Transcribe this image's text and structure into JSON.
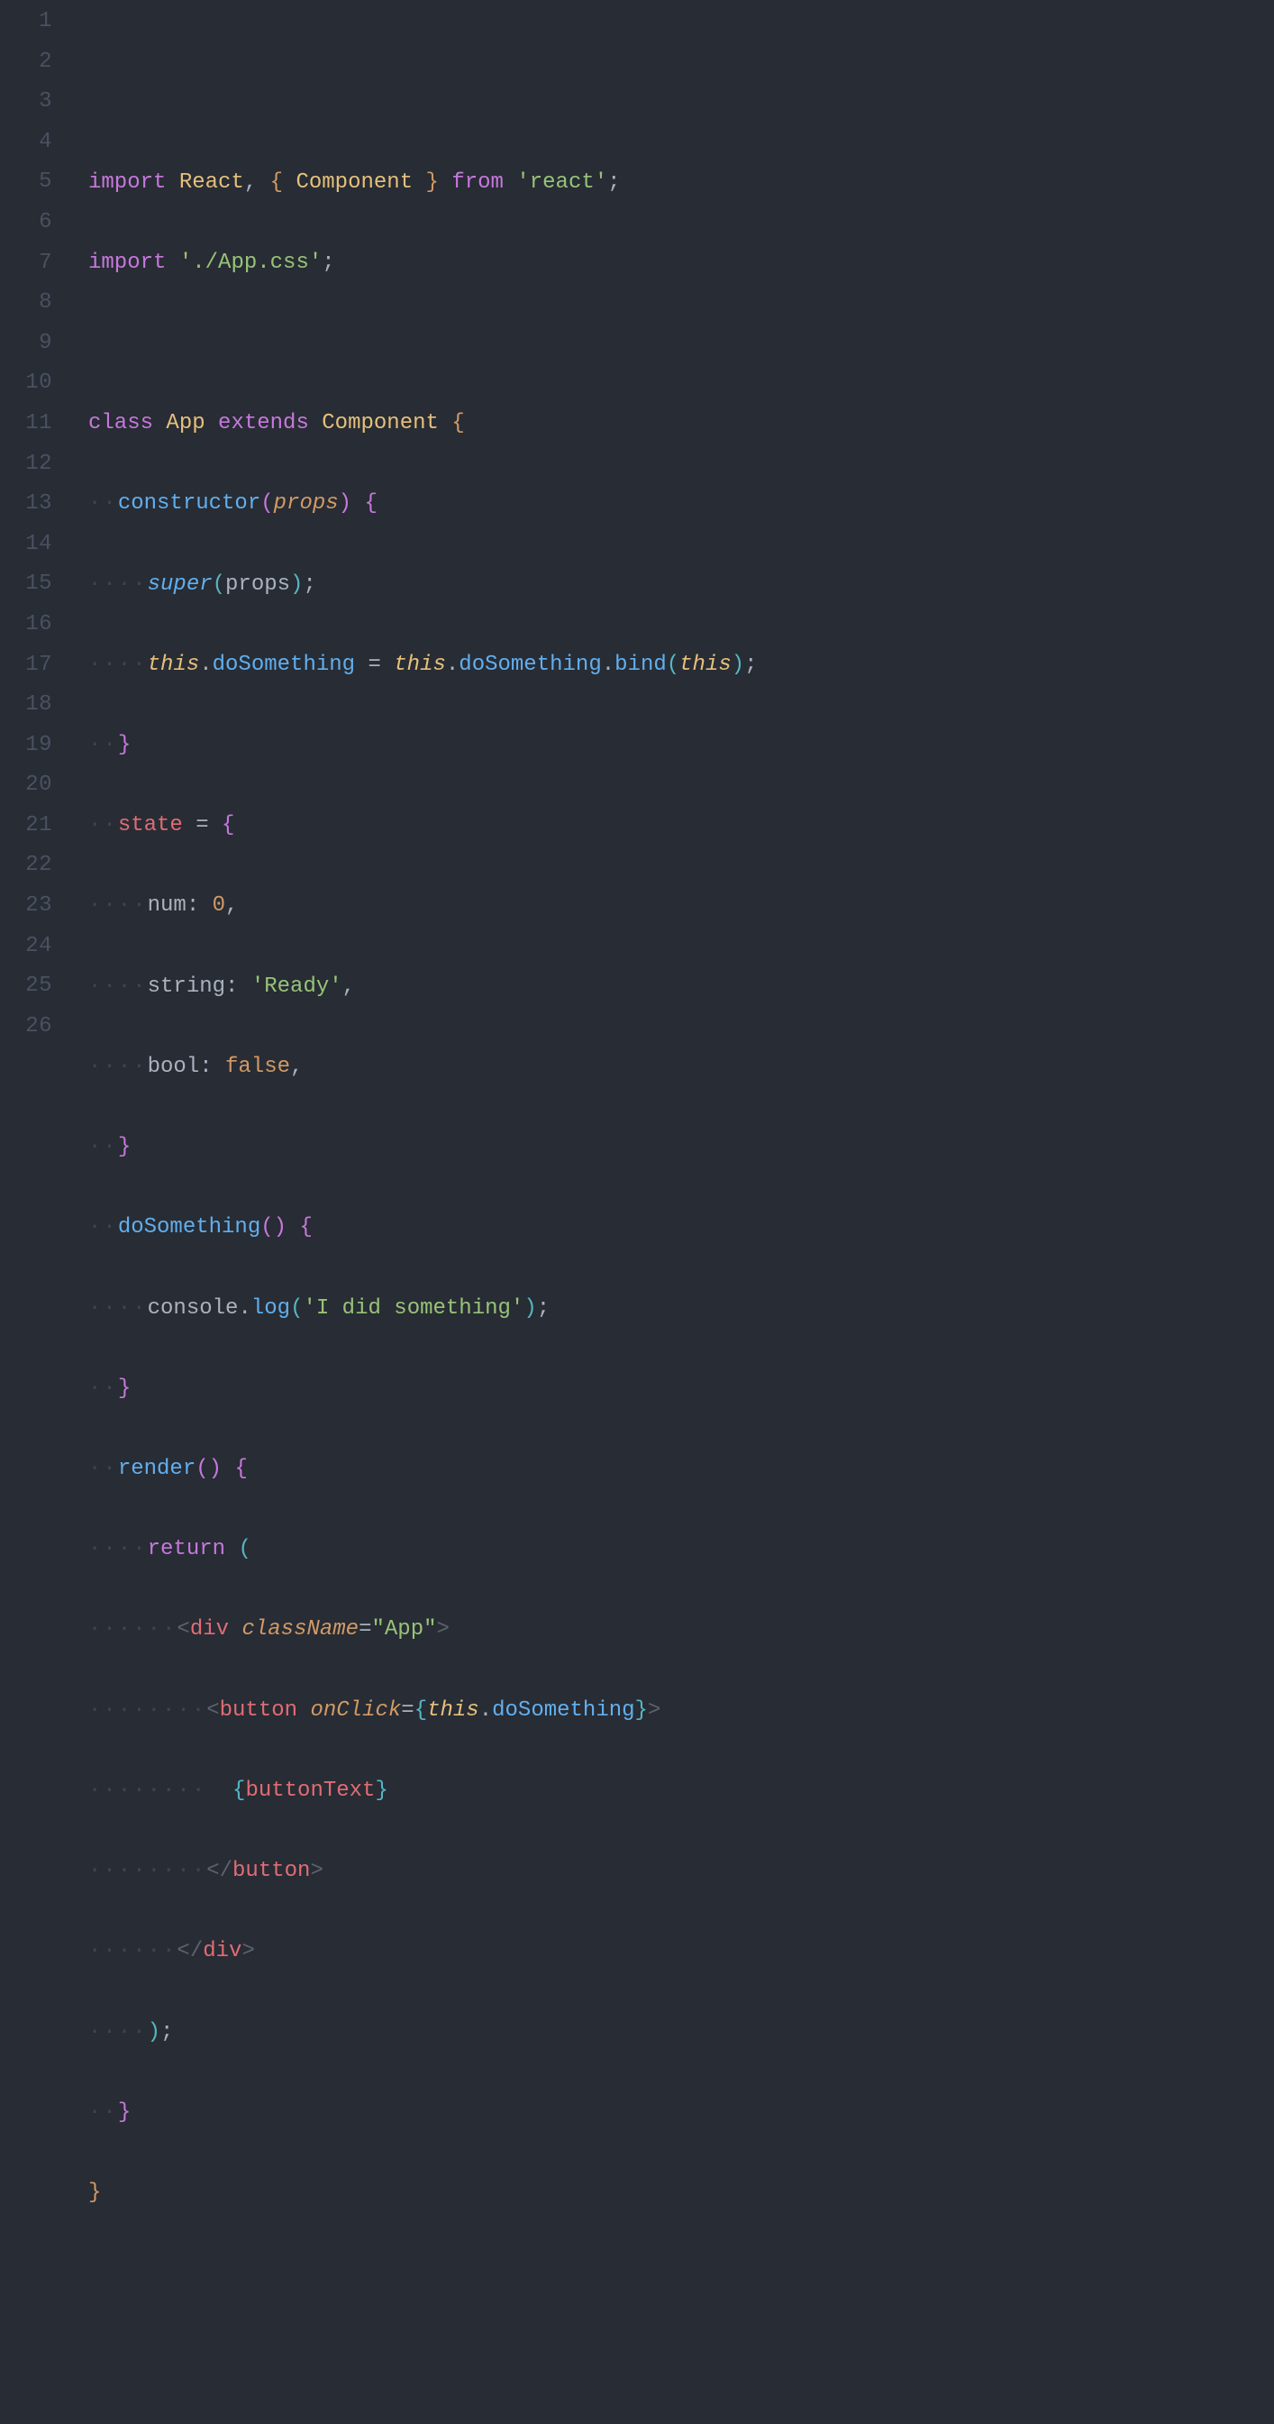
{
  "lineCount": 26,
  "tokens": {
    "l1": {
      "t1": "import",
      "t2": "React",
      "t3": ",",
      "t4": "{",
      "t5": "Component",
      "t6": "}",
      "t7": "from",
      "t8": "'react'",
      "t9": ";"
    },
    "l2": {
      "t1": "import",
      "t2": "'./App.css'",
      "t3": ";"
    },
    "l4": {
      "t1": "class",
      "t2": "App",
      "t3": "extends",
      "t4": "Component",
      "t5": "{"
    },
    "l5": {
      "t1": "constructor",
      "t2": "(",
      "t3": "props",
      "t4": ")",
      "t5": "{"
    },
    "l6": {
      "t1": "super",
      "t2": "(",
      "t3": "props",
      "t4": ")",
      "t5": ";"
    },
    "l7": {
      "t1": "this",
      "t2": ".",
      "t3": "doSomething",
      "t4": "=",
      "t5": "this",
      "t6": ".",
      "t7": "doSomething",
      "t8": ".",
      "t9": "bind",
      "t10": "(",
      "t11": "this",
      "t12": ")",
      "t13": ";"
    },
    "l8": {
      "t1": "}"
    },
    "l9": {
      "t1": "state",
      "t2": "=",
      "t3": "{"
    },
    "l10": {
      "t1": "num",
      "t2": ":",
      "t3": "0",
      "t4": ","
    },
    "l11": {
      "t1": "string",
      "t2": ":",
      "t3": "'Ready'",
      "t4": ","
    },
    "l12": {
      "t1": "bool",
      "t2": ":",
      "t3": "false",
      "t4": ","
    },
    "l13": {
      "t1": "}"
    },
    "l14": {
      "t1": "doSomething",
      "t2": "(",
      "t3": ")",
      "t4": "{"
    },
    "l15": {
      "t1": "console",
      "t2": ".",
      "t3": "log",
      "t4": "(",
      "t5": "'I did something'",
      "t6": ")",
      "t7": ";"
    },
    "l16": {
      "t1": "}"
    },
    "l17": {
      "t1": "render",
      "t2": "(",
      "t3": ")",
      "t4": "{"
    },
    "l18": {
      "t1": "return",
      "t2": "("
    },
    "l19": {
      "t1": "<",
      "t2": "div",
      "t3": "className",
      "t4": "=",
      "t5": "\"App\"",
      "t6": ">"
    },
    "l20": {
      "t1": "<",
      "t2": "button",
      "t3": "onClick",
      "t4": "=",
      "t5": "{",
      "t6": "this",
      "t7": ".",
      "t8": "doSomething",
      "t9": "}",
      "t10": ">"
    },
    "l21": {
      "t1": "{",
      "t2": "buttonText",
      "t3": "}"
    },
    "l22": {
      "t1": "</",
      "t2": "button",
      "t3": ">"
    },
    "l23": {
      "t1": "</",
      "t2": "div",
      "t3": ">"
    },
    "l24": {
      "t1": ")",
      "t2": ";"
    },
    "l25": {
      "t1": "}"
    },
    "l26": {
      "t1": "}"
    }
  },
  "ws": {
    "d2": "··",
    "d4": "····",
    "d6": "······",
    "d8": "········"
  }
}
